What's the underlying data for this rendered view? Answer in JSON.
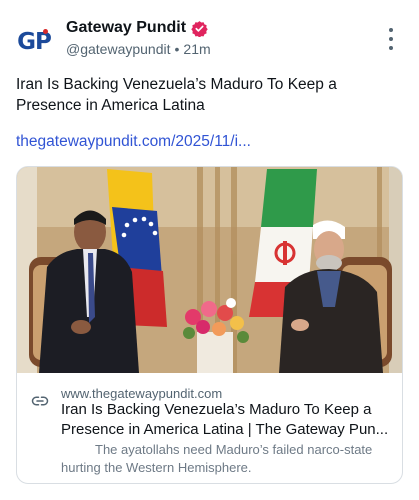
{
  "author": {
    "avatar_text": "GP",
    "name": "Gateway Pundit",
    "verified": true,
    "handle": "@gatewaypundit",
    "separator": "•",
    "time": "21m"
  },
  "post": {
    "text": "Iran Is Backing Venezuela’s Maduro To Keep a Presence in America Latina",
    "link_text": "thegatewaypundit.com/2025/11/i..."
  },
  "card": {
    "domain": "www.thegatewaypundit.com",
    "title": "Iran Is Backing Venezuela’s Maduro To Keep a Presence in America Latina | The Gateway Pun...",
    "description": "The ayatollahs need Maduro’s failed narco-state hurting the Western Hemisphere."
  },
  "colors": {
    "link": "#3154d4",
    "badge": "#e0245e",
    "avatar": "#1c4a9a"
  }
}
